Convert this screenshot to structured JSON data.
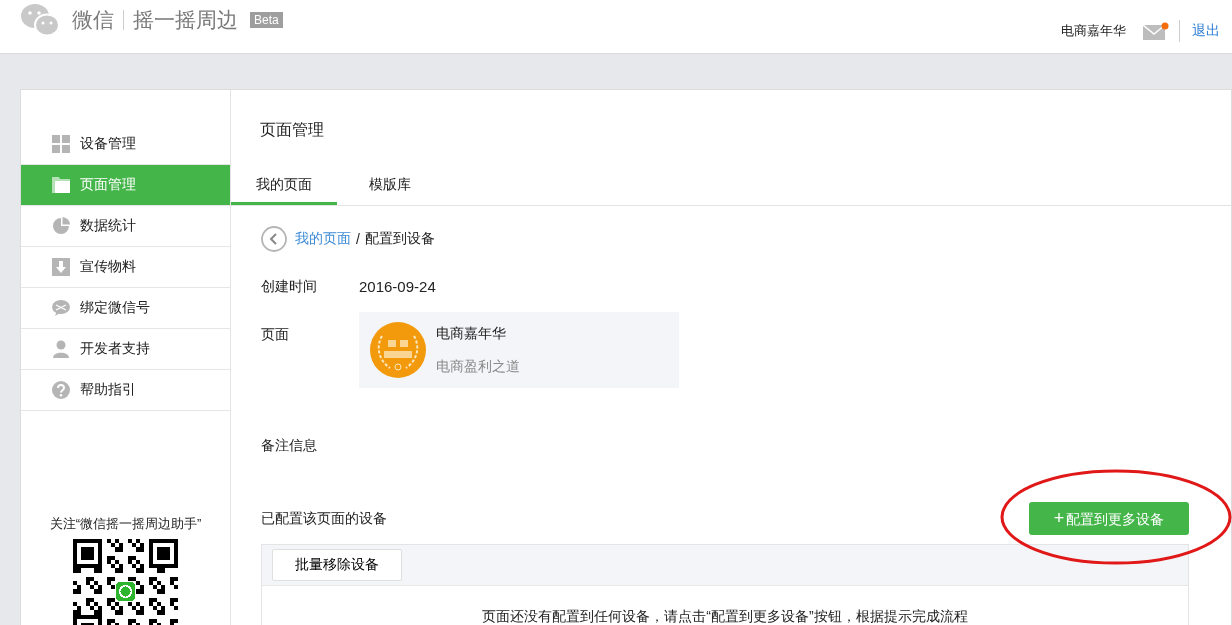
{
  "header": {
    "brand": "微信",
    "product": "摇一摇周边",
    "badge": "Beta",
    "account": "电商嘉年华",
    "has_unread": true,
    "logout": "退出"
  },
  "sidebar": {
    "items": [
      {
        "label": "设备管理",
        "selected": false
      },
      {
        "label": "页面管理",
        "selected": true
      },
      {
        "label": "数据统计",
        "selected": false
      },
      {
        "label": "宣传物料",
        "selected": false
      },
      {
        "label": "绑定微信号",
        "selected": false
      },
      {
        "label": "开发者支持",
        "selected": false
      },
      {
        "label": "帮助指引",
        "selected": false
      }
    ],
    "follow_caption": "关注“微信摇一摇周边助手”"
  },
  "content": {
    "title": "页面管理",
    "tabs": [
      {
        "label": "我的页面",
        "selected": true
      },
      {
        "label": "模版库",
        "selected": false
      }
    ],
    "breadcrumb": {
      "link": "我的页面",
      "separator": "/",
      "current": "配置到设备"
    },
    "fields": [
      {
        "kind": "text",
        "label": "创建时间",
        "value": "2016-09-24"
      },
      {
        "kind": "page",
        "label": "页面",
        "title": "电商嘉年华",
        "subtitle": "电商盈利之道"
      },
      {
        "kind": "text",
        "label": "备注信息"
      }
    ],
    "devices": {
      "label": "已配置该页面的设备",
      "add_button": "配置到更多设备",
      "add_icon": "+",
      "batch_button": "批量移除设备",
      "empty_message": "页面还没有配置到任何设备，请点击“配置到更多设备”按钮，根据提示完成流程"
    }
  }
}
